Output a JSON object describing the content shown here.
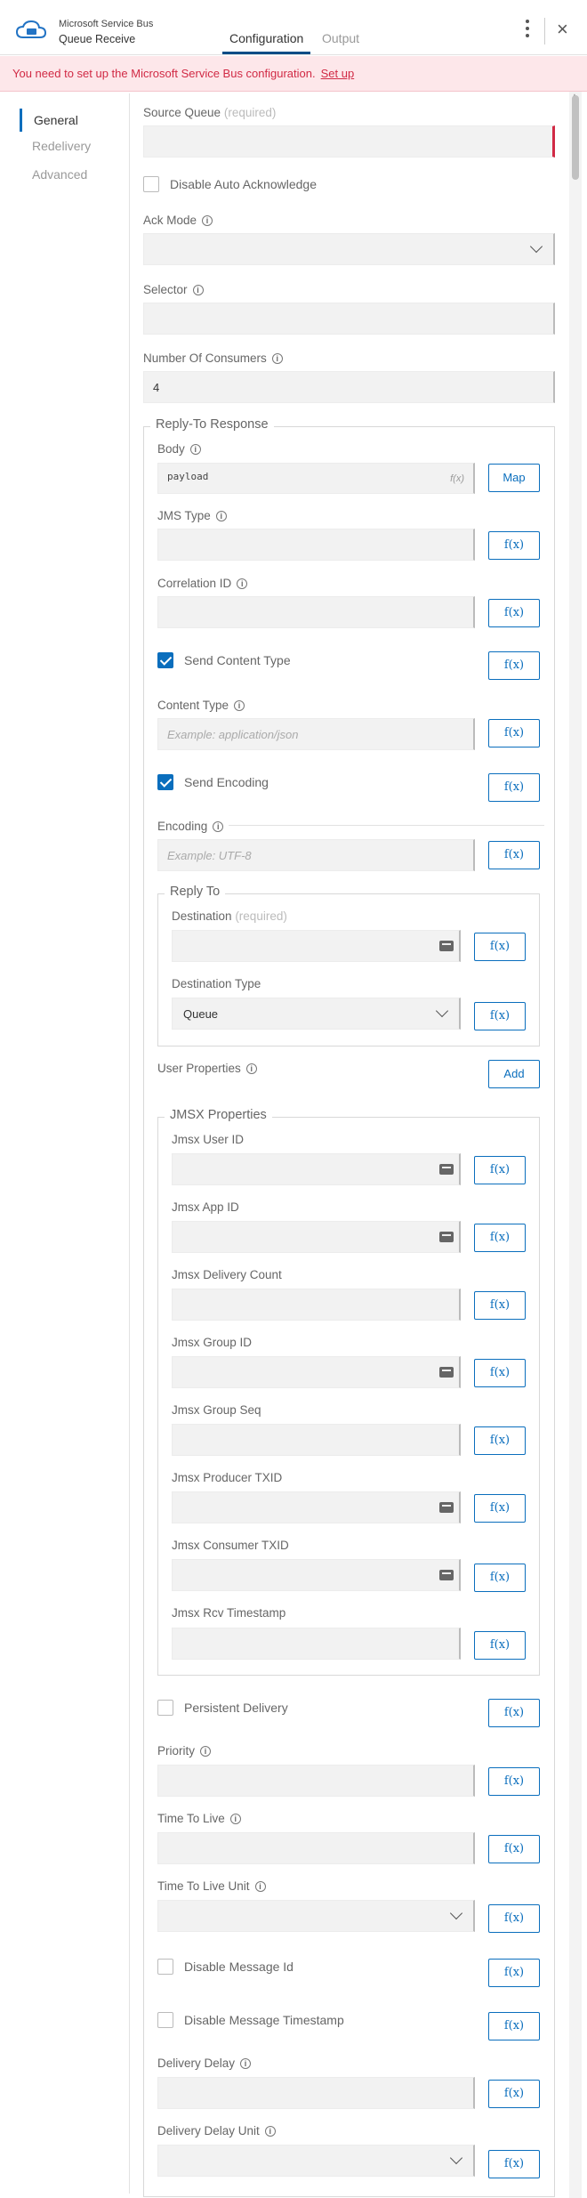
{
  "header": {
    "app_name": "Microsoft Service Bus",
    "app_sub": "Queue Receive",
    "tabs": [
      "Configuration",
      "Output"
    ]
  },
  "banner": {
    "text": "You need to set up the Microsoft Service Bus configuration.",
    "link": "Set up"
  },
  "sidebar": {
    "items": [
      "General",
      "Redelivery",
      "Advanced"
    ]
  },
  "form": {
    "source_queue": {
      "label": "Source Queue",
      "req": "(required)",
      "value": ""
    },
    "disable_auto_ack": {
      "label": "Disable Auto Acknowledge",
      "checked": false
    },
    "ack_mode": {
      "label": "Ack Mode",
      "value": ""
    },
    "selector": {
      "label": "Selector",
      "value": ""
    },
    "num_consumers": {
      "label": "Number Of Consumers",
      "value": "4"
    }
  },
  "reply": {
    "legend": "Reply-To Response",
    "body": {
      "label": "Body",
      "value": "payload",
      "fx": "f(x)",
      "btn": "Map"
    },
    "jms_type": {
      "label": "JMS Type"
    },
    "correlation_id": {
      "label": "Correlation ID"
    },
    "send_content_type": {
      "label": "Send Content Type",
      "checked": true
    },
    "content_type": {
      "label": "Content Type",
      "placeholder": "Example: application/json"
    },
    "send_encoding": {
      "label": "Send Encoding",
      "checked": true
    },
    "encoding": {
      "label": "Encoding",
      "placeholder": "Example: UTF-8"
    },
    "reply_to": {
      "legend": "Reply To",
      "destination": {
        "label": "Destination",
        "req": "(required)"
      },
      "destination_type": {
        "label": "Destination Type",
        "value": "Queue"
      }
    },
    "user_properties": {
      "label": "User Properties",
      "btn": "Add"
    },
    "jmsx": {
      "legend": "JMSX Properties",
      "fields": [
        "Jmsx User ID",
        "Jmsx App ID",
        "Jmsx Delivery Count",
        "Jmsx Group ID",
        "Jmsx Group Seq",
        "Jmsx Producer TXID",
        "Jmsx Consumer TXID",
        "Jmsx Rcv Timestamp"
      ]
    },
    "persistent_delivery": {
      "label": "Persistent Delivery",
      "checked": false
    },
    "priority": {
      "label": "Priority"
    },
    "time_to_live": {
      "label": "Time To Live"
    },
    "time_to_live_unit": {
      "label": "Time To Live Unit"
    },
    "disable_message_id": {
      "label": "Disable Message Id",
      "checked": false
    },
    "disable_message_timestamp": {
      "label": "Disable Message Timestamp",
      "checked": false
    },
    "delivery_delay": {
      "label": "Delivery Delay"
    },
    "delivery_delay_unit": {
      "label": "Delivery Delay Unit"
    }
  },
  "fx_label": "f(x)",
  "info_glyph": "i",
  "colors": {
    "accent": "#0a6ebd",
    "error": "#d12a45",
    "banner_bg": "#fde7ea"
  }
}
